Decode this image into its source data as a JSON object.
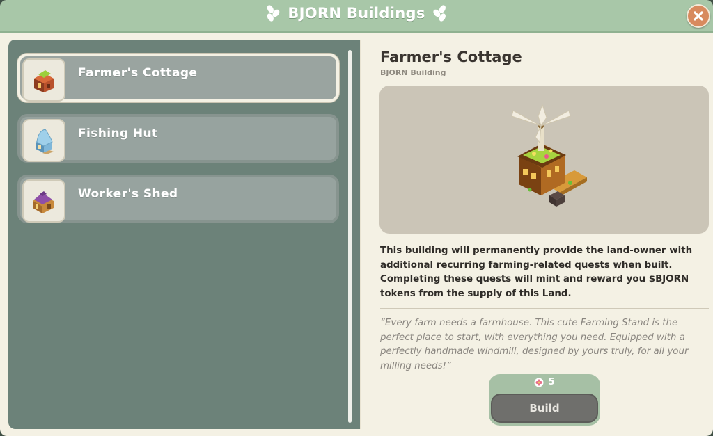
{
  "window": {
    "title": "BJORN Buildings"
  },
  "buildings": [
    {
      "label": "Farmer's Cottage",
      "icon": "farmers-cottage-icon",
      "selected": true
    },
    {
      "label": "Fishing Hut",
      "icon": "fishing-hut-icon",
      "selected": false
    },
    {
      "label": "Worker's Shed",
      "icon": "workers-shed-icon",
      "selected": false
    }
  ],
  "detail": {
    "title": "Farmer's Cottage",
    "subtitle": "BJORN Building",
    "preview_icon": "windmill-cottage-image",
    "description_lines": [
      "This building will permanently provide the land-owner with",
      "additional recurring farming-related quests when built.",
      "Completing these quests will mint and reward you $BJORN",
      "tokens from the supply of this Land."
    ],
    "quote_lines": [
      "“Every farm needs a farmhouse. This cute Farming Stand is the",
      "perfect place to start, with everything you need. Equipped with a",
      "perfectly handmade windmill, designed by yours truly, for all your",
      "milling needs!”"
    ],
    "cost": "5",
    "cost_icon": "flower-token-icon",
    "build_label": "Build"
  },
  "colors": {
    "titlebar": "#a8c7a8",
    "panel": "#6c8279",
    "background": "#f4f1e4",
    "build_button": "#6f6f6c"
  }
}
